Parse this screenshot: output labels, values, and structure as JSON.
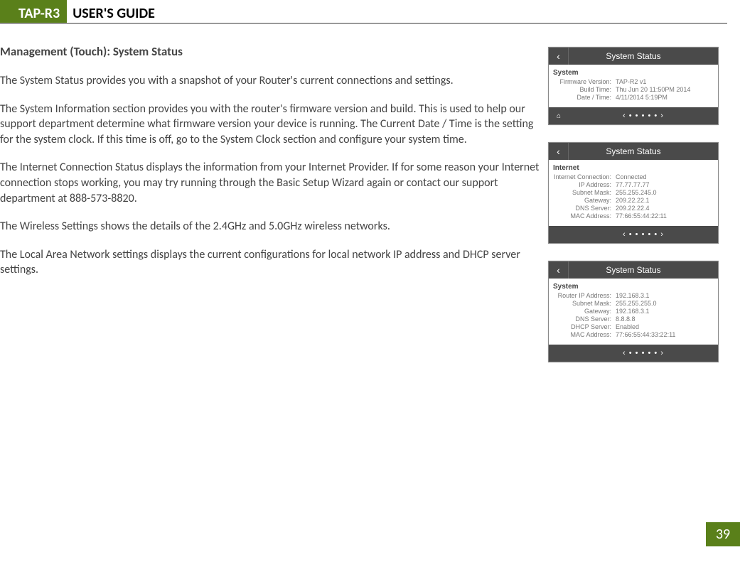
{
  "header": {
    "badge": "TAP-R3",
    "title": "USER'S GUIDE"
  },
  "section_heading": "Management (Touch): System Status",
  "paragraphs": {
    "p1": "The System Status provides you with a snapshot of your Router's current connections and settings.",
    "p2": "The System Information section provides you with the router's firmware version and build.  This is used to help our support department determine what firmware version your device is running.  The Current Date / Time is the setting for the system clock.  If this time is off, go to the System Clock section and configure your system time.",
    "p3": "The Internet Connection Status displays the information from your Internet Provider.  If for some reason your Internet connection stops working, you may try running through the Basic Setup Wizard again or contact our support department at 888-573-8820.",
    "p4": "The Wireless Settings shows the details of the 2.4GHz and 5.0GHz wireless networks.",
    "p5": "The Local Area Network settings displays the current configurations for local network IP address and DHCP server settings."
  },
  "screens": {
    "s1": {
      "title": "System Status",
      "section": "System",
      "rows": [
        {
          "label": "Firmware Version:",
          "value": "TAP-R2 v1"
        },
        {
          "label": "Build Time:",
          "value": "Thu Jun 20 11:50PM 2014"
        },
        {
          "label": "Date / Time:",
          "value": "4/11/2014 5:19PM"
        }
      ],
      "footer_home": "⌂",
      "footer_nav": "‹ • • • • • ›"
    },
    "s2": {
      "title": "System Status",
      "section": "Internet",
      "rows": [
        {
          "label": "Internet Connection:",
          "value": "Connected"
        },
        {
          "label": "IP Address:",
          "value": "77.77.77.77"
        },
        {
          "label": "Subnet Mask:",
          "value": "255.255.245.0"
        },
        {
          "label": "Gateway:",
          "value": "209.22.22.1"
        },
        {
          "label": "DNS Server:",
          "value": "209.22.22.4"
        },
        {
          "label": "MAC Address:",
          "value": "77:66:55:44:22:11"
        }
      ],
      "footer_nav": "‹ • • • • • ›"
    },
    "s3": {
      "title": "System Status",
      "section": "System",
      "rows": [
        {
          "label": "Router IP Address:",
          "value": "192.168.3.1"
        },
        {
          "label": "Subnet Mask:",
          "value": "255.255.255.0"
        },
        {
          "label": "Gateway:",
          "value": "192.168.3.1"
        },
        {
          "label": "DNS Server:",
          "value": "8.8.8.8"
        },
        {
          "label": "DHCP Server:",
          "value": "Enabled"
        },
        {
          "label": "MAC Address:",
          "value": "77:66:55:44:33:22:11"
        }
      ],
      "footer_nav": "‹ • • • • • ›"
    }
  },
  "page_number": "39"
}
